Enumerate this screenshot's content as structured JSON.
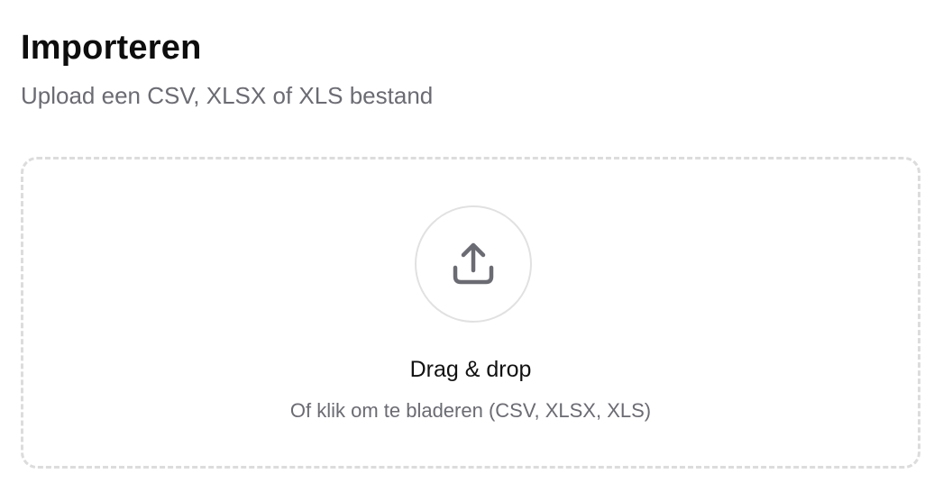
{
  "header": {
    "title": "Importeren",
    "subtitle": "Upload een CSV, XLSX of XLS bestand"
  },
  "dropzone": {
    "icon": "upload-icon",
    "title": "Drag & drop",
    "hint": "Of klik om te bladeren (CSV, XLSX, XLS)"
  },
  "colors": {
    "title": "#0d0d0d",
    "muted_text": "#6b6b73",
    "dashed_border": "#dcdcdc",
    "icon_stroke": "#6b6b73"
  }
}
